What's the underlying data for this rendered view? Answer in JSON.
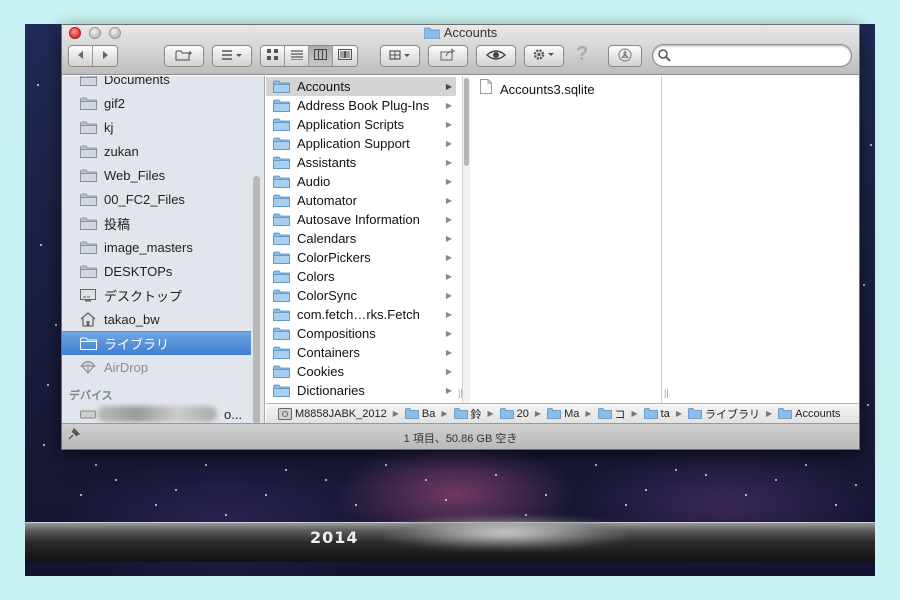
{
  "window": {
    "title": "Accounts",
    "status": "1 項目、50.86 GB 空き"
  },
  "toolbar": {
    "back_icon": "chevron-left-icon",
    "forward_icon": "chevron-right-icon",
    "new_folder_icon": "new-folder-icon",
    "arrange_icon": "list-arrange-icon",
    "views": [
      "icon-view",
      "list-view",
      "column-view",
      "coverflow-view"
    ],
    "active_view": "column-view",
    "share_icon": "share-icon",
    "quicklook_icon": "eye-icon",
    "action_icon": "gear-icon",
    "help_glyph": "?",
    "burn_icon": "burn-icon",
    "search_placeholder": ""
  },
  "sidebar": {
    "items": [
      {
        "label": "Documents",
        "icon": "folder-icon"
      },
      {
        "label": "gif2",
        "icon": "folder-icon"
      },
      {
        "label": "kj",
        "icon": "folder-icon"
      },
      {
        "label": "zukan",
        "icon": "folder-icon"
      },
      {
        "label": "Web_Files",
        "icon": "folder-icon"
      },
      {
        "label": "00_FC2_Files",
        "icon": "folder-icon"
      },
      {
        "label": "投稿",
        "icon": "folder-icon"
      },
      {
        "label": "image_masters",
        "icon": "folder-icon"
      },
      {
        "label": "DESKTOPs",
        "icon": "folder-icon"
      },
      {
        "label": "デスクトップ",
        "icon": "desktop-icon"
      },
      {
        "label": "takao_bw",
        "icon": "home-icon"
      },
      {
        "label": "ライブラリ",
        "icon": "folder-icon",
        "selected": true
      },
      {
        "label": "AirDrop",
        "icon": "airdrop-icon",
        "dim": true
      }
    ],
    "devices_heading": "デバイス",
    "device_label": "o..."
  },
  "columns": {
    "col1": [
      "Accounts",
      "Address Book Plug-Ins",
      "Application Scripts",
      "Application Support",
      "Assistants",
      "Audio",
      "Automator",
      "Autosave Information",
      "Calendars",
      "ColorPickers",
      "Colors",
      "ColorSync",
      "com.fetch…rks.Fetch",
      "Compositions",
      "Containers",
      "Cookies",
      "Dictionaries"
    ],
    "col1_selected": "Accounts",
    "col2_file": "Accounts3.sqlite"
  },
  "pathbar": {
    "crumbs": [
      {
        "label": "M8858JABK_2012",
        "icon": "disk-icon"
      },
      {
        "label": "Ba",
        "icon": "folder-icon"
      },
      {
        "label": "鈴",
        "icon": "folder-icon"
      },
      {
        "label": "20",
        "icon": "folder-icon"
      },
      {
        "label": "Ma",
        "icon": "folder-icon"
      },
      {
        "label": "コ",
        "icon": "folder-icon"
      },
      {
        "label": "ta",
        "icon": "folder-icon"
      },
      {
        "label": "ライブラリ",
        "icon": "folder-icon"
      },
      {
        "label": "Accounts",
        "icon": "folder-icon"
      }
    ]
  },
  "dock": {
    "text": "2014"
  },
  "colors": {
    "selection_blue": "#3f7fd1",
    "folder_blue": "#7fb2e0",
    "sidebar_bg": "#e1e6ed"
  }
}
